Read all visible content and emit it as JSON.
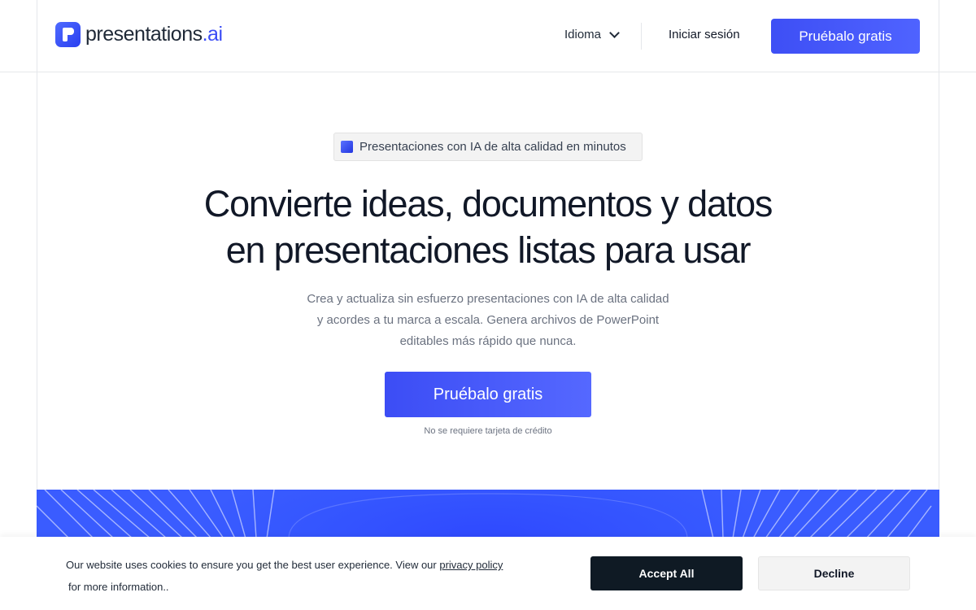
{
  "header": {
    "logo_text": "presentations",
    "logo_tld": ".ai",
    "language_label": "Idioma",
    "login_label": "Iniciar sesión",
    "cta_label": "Pruébalo gratis"
  },
  "hero": {
    "badge_text": "Presentaciones con IA de alta calidad en minutos",
    "headline_line1": "Convierte ideas, documentos y datos",
    "headline_line2": "en presentaciones listas para usar",
    "sub_line1": "Crea y actualiza sin esfuerzo presentaciones con IA de alta calidad",
    "sub_line2": "y acordes a tu marca a escala. Genera archivos de PowerPoint",
    "sub_line3": "editables más rápido que nunca.",
    "cta_label": "Pruébalo gratis",
    "cta_note": "No se requiere tarjeta de crédito"
  },
  "cookie_banner": {
    "text_before_link": "Our website uses cookies to ensure you get the best user experience. View our ",
    "link_text": "privacy policy",
    "text_after_link": "for more information..",
    "accept_label": "Accept All",
    "decline_label": "Decline"
  },
  "colors": {
    "brand": "#3e4ff5",
    "banner": "#3a5cff",
    "accept_bg": "#0f1a24"
  },
  "icons": {
    "logo": "presentations-logo-icon",
    "badge": "square-badge-icon",
    "language": "chevron-down-icon"
  }
}
